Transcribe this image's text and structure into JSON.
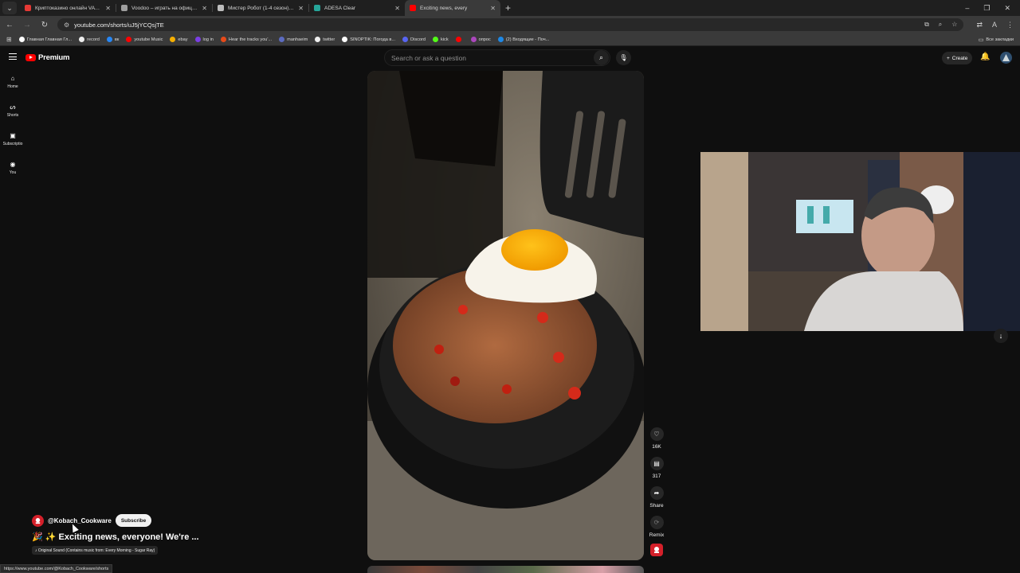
{
  "browser": {
    "tabs": [
      {
        "label": "Криптоказино онлайн VAVADA",
        "color": "#e53935",
        "active": false
      },
      {
        "label": "Voodoo – играть на официальном",
        "color": "#9e9e9e",
        "active": false
      },
      {
        "label": "Мистер Робот (1-4 сезон) смотреть",
        "color": "#bdbdbd",
        "active": false
      },
      {
        "label": "ADESA Clear",
        "color": "#26a69a",
        "active": false
      },
      {
        "label": "Exciting news, every",
        "color": "#ff0000",
        "active": true
      }
    ],
    "url": "youtube.com/shorts/uJ5jYCQsjTE",
    "bookmarks": [
      {
        "label": "Главная Главная Гл...",
        "color": "#ffffff"
      },
      {
        "label": "record",
        "color": "#eeeeee"
      },
      {
        "label": "вк",
        "color": "#2787f5"
      },
      {
        "label": "youtube Music",
        "color": "#ff0000"
      },
      {
        "label": "ebay",
        "color": "#f5af02"
      },
      {
        "label": "log in",
        "color": "#7b3fe4"
      },
      {
        "label": "Hear the tracks you'...",
        "color": "#e64a19"
      },
      {
        "label": "manhaeim",
        "color": "#5c6bc0"
      },
      {
        "label": "twitter",
        "color": "#eeeeee"
      },
      {
        "label": "SINOPTIK: Погода в...",
        "color": "#ffffff"
      },
      {
        "label": "Discord",
        "color": "#5865f2"
      },
      {
        "label": "kick",
        "color": "#53fc18"
      },
      {
        "label": "",
        "color": "#ff0000"
      },
      {
        "label": "опрос",
        "color": "#ab47bc"
      },
      {
        "label": "(2) Входящие - Поч...",
        "color": "#1e88e5"
      }
    ],
    "all_bookmarks": "Все закладки",
    "status_url": "https://www.youtube.com/@Kobach_Cookware/shorts"
  },
  "youtube": {
    "logo": "Premium",
    "search_placeholder": "Search or ask a question",
    "create": "Create",
    "sidebar": [
      {
        "label": "Home",
        "icon": "home-icon",
        "glyph": "⌂"
      },
      {
        "label": "Shorts",
        "icon": "shorts-icon",
        "glyph": "ᔕ"
      },
      {
        "label": "Subscriptio",
        "icon": "subscriptions-icon",
        "glyph": "▣"
      },
      {
        "label": "You",
        "icon": "you-icon",
        "glyph": "◉"
      }
    ],
    "actions": {
      "likes": "16K",
      "comments": "317",
      "share": "Share",
      "remix": "Remix"
    },
    "channel": "@Kobach_Cookware",
    "subscribe": "Subscribe",
    "title": "🎉 ✨ Exciting news, everyone! We're ...",
    "sound": "♪ Original Sound (Contains music from: Every Morning - Sugar Ray)"
  },
  "colors": {
    "accent": "#ff0000",
    "background": "#0f0f0f"
  }
}
